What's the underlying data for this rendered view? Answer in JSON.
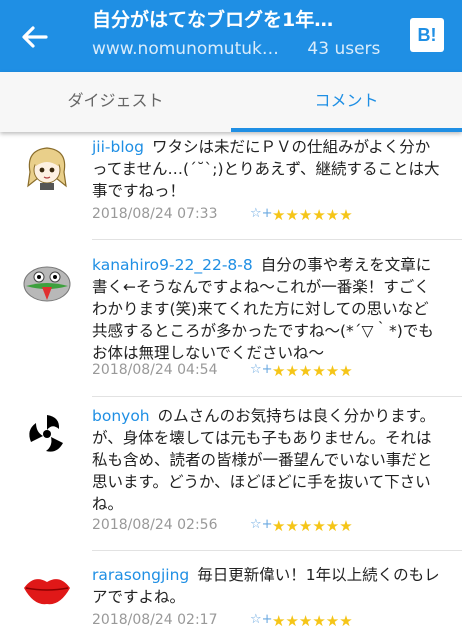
{
  "header": {
    "title": "自分がはてなブログを1年…",
    "url": "www.nomunomutuk…",
    "users": "43 users",
    "hatena_logo": "B!"
  },
  "tabs": [
    {
      "label": "ダイジェスト",
      "active": false
    },
    {
      "label": "コメント",
      "active": true
    }
  ],
  "comments": [
    {
      "user": "jii-blog",
      "text": "ワタシは未だにＰＶの仕組みがよく分かってません…(´˘`;)とりあえず、継続することは大事ですねっ！",
      "date": "2018/08/24 07:33",
      "stars": "★★★★★★",
      "avatar": "anime-girl-avatar"
    },
    {
      "user": "kanahiro9-22_22-8-8",
      "text": "自分の事や考えを文章に書く←そうなんですよね〜これが一番楽！すごくわかります(笑)来てくれた方に対しての思いなど共感するところが多かったですね〜(*´▽｀*)でもお体は無理しないでくださいね〜",
      "date": "2018/08/24 04:54",
      "stars": "★★★★★★",
      "avatar": "character-avatar"
    },
    {
      "user": "bonyoh",
      "text": "のムさんのお気持ちは良く分かります。が、身体を壊しては元も子もありません。それは私も含め、読者の皆様が一番望んでいない事だと思います。どうか、ほどほどに手を抜いて下さいね。",
      "date": "2018/08/24 02:56",
      "stars": "★★★★★★",
      "avatar": "tomoe-avatar"
    },
    {
      "user": "rarasongjing",
      "text": "毎日更新偉い！1年以上続くのもレアですよね。",
      "date": "2018/08/24 02:17",
      "stars": "★★★★★★",
      "avatar": "lips-avatar"
    }
  ],
  "add_star_glyph": "☆+",
  "colors": {
    "accent": "#1f8fe4",
    "star": "#f5c518"
  }
}
